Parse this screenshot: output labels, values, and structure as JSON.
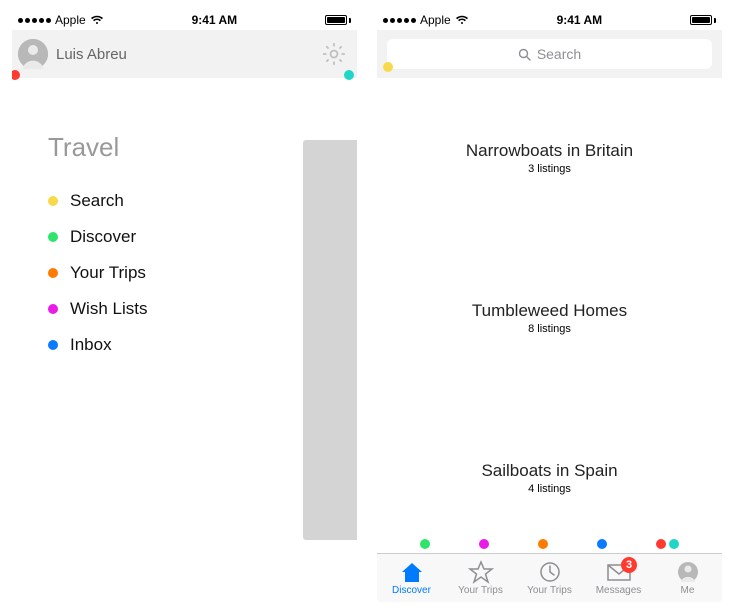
{
  "status": {
    "carrier": "Apple",
    "time": "9:41 AM"
  },
  "phone1": {
    "username": "Luis Abreu",
    "section_title": "Travel",
    "menu": [
      {
        "label": "Search",
        "color": "#f8d94a"
      },
      {
        "label": "Discover",
        "color": "#2ee46b"
      },
      {
        "label": "Your Trips",
        "color": "#ff7a00"
      },
      {
        "label": "Wish Lists",
        "color": "#e81be8"
      },
      {
        "label": "Inbox",
        "color": "#0a7aff"
      }
    ],
    "anno_red": "#ff3b30",
    "anno_teal": "#1fd6c9"
  },
  "phone2": {
    "search_placeholder": "Search",
    "cards": [
      {
        "title": "Narrowboats in Britain",
        "sub": "3 listings"
      },
      {
        "title": "Tumbleweed Homes",
        "sub": "8 listings"
      },
      {
        "title": "Sailboats in Spain",
        "sub": "4 listings"
      }
    ],
    "tabs": [
      {
        "label": "Discover",
        "active": true
      },
      {
        "label": "Your Trips"
      },
      {
        "label": "Your Trips"
      },
      {
        "label": "Messages",
        "badge": "3"
      },
      {
        "label": "Me"
      }
    ],
    "dotrow_colors": [
      "#2ee46b",
      "#e81be8",
      "#ff7a00",
      "#0a7aff",
      "#ff3b30",
      "#1fd6c9"
    ],
    "anno_yellow": "#f8d94a"
  }
}
